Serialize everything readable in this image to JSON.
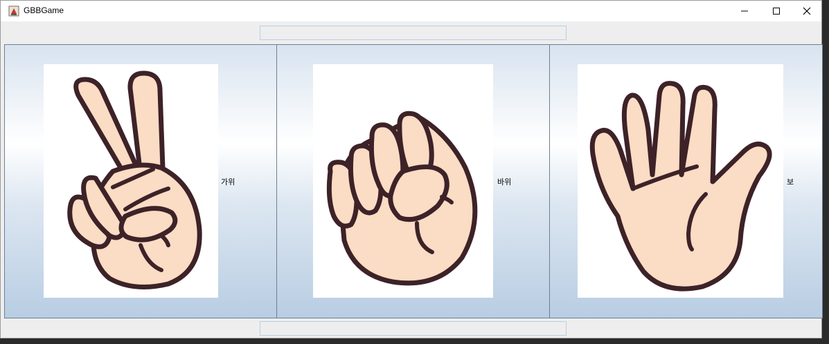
{
  "window": {
    "title": "GBBGame"
  },
  "status": {
    "top_field_value": "",
    "bottom_field_value": ""
  },
  "choices": [
    {
      "label": "가위",
      "icon": "scissors-hand-icon"
    },
    {
      "label": "바위",
      "icon": "rock-fist-icon"
    },
    {
      "label": "보",
      "icon": "paper-palm-icon"
    }
  ],
  "colors": {
    "skin": "#fbdcc4",
    "outline": "#3d2228",
    "panel_blue": "#b8cde3"
  }
}
